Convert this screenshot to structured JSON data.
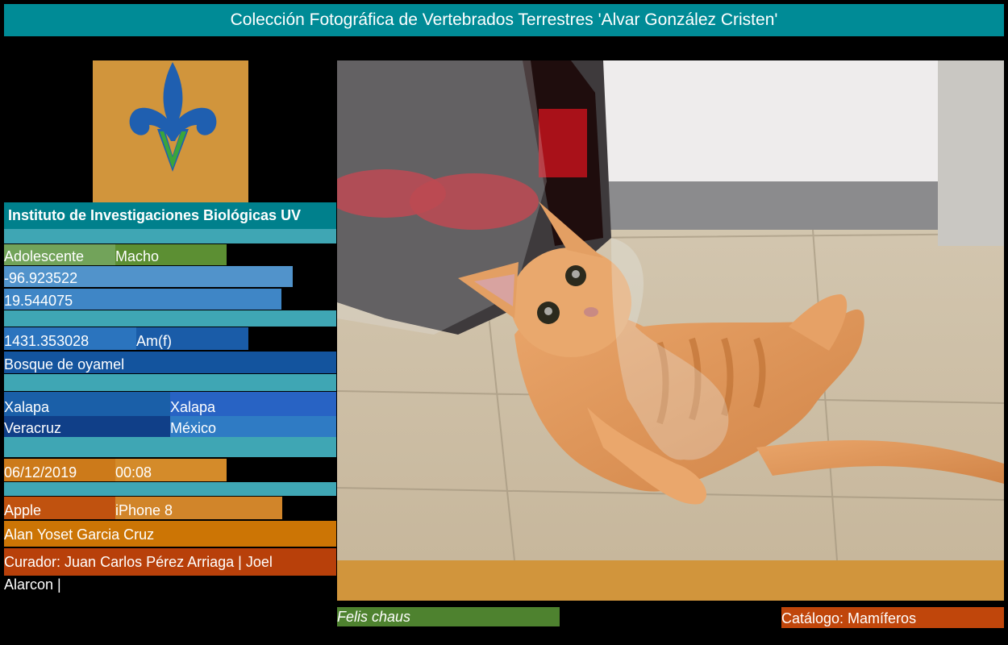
{
  "header": {
    "title": "Colección Fotográfica de Vertebrados Terrestres 'Alvar González Cristen'"
  },
  "logo": {
    "name": "uv-fleur-de-lis-logo",
    "letter": "V"
  },
  "institute": {
    "name": "Instituto de Investigaciones Biológicas UV"
  },
  "specimen": {
    "age": "Adolescente",
    "sex": "Macho",
    "longitude": "-96.923522",
    "latitude": "19.544075",
    "altitude": "1431.353028",
    "vegetation_code": "Am(f)",
    "habitat": "Bosque de oyamel",
    "locality": "Xalapa",
    "municipality": "Xalapa",
    "state": "Veracruz",
    "country": "México",
    "date": "06/12/2019",
    "time": "00:08",
    "camera_make": "Apple",
    "camera_model": "iPhone 8",
    "photographer": "Alan Yoset Garcia Cruz",
    "curators_line1": "Curador: Juan Carlos Pérez Arriaga | Joel",
    "curators_line2": "Alarcon |"
  },
  "photo": {
    "subject": "orange tabby cat lying on tiled floor"
  },
  "footer": {
    "species": "Felis chaus",
    "catalog": "Catálogo: Mamíferos"
  },
  "colors": {
    "banner": "#008b96",
    "orange": "#d1953c",
    "green": "#4e822f",
    "rust": "#c0460b"
  }
}
